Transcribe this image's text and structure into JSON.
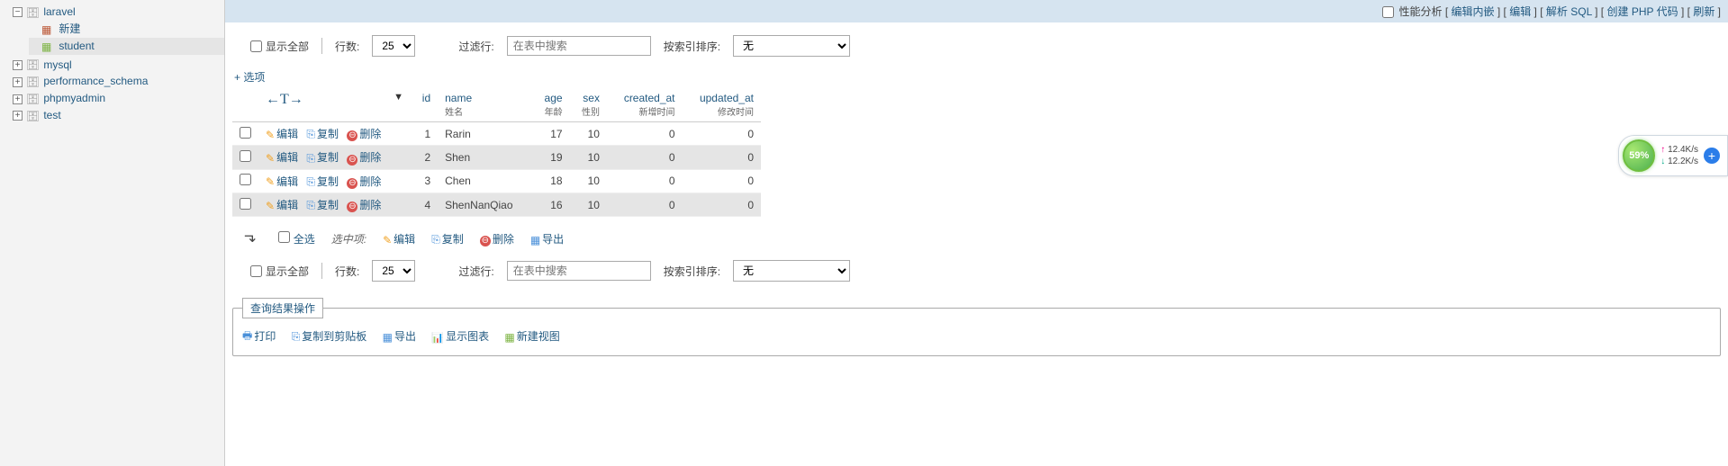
{
  "sidebar": {
    "databases": [
      {
        "name": "laravel",
        "expanded": true,
        "children": [
          {
            "name": "新建",
            "type": "new"
          },
          {
            "name": "student",
            "type": "table",
            "selected": true
          }
        ]
      },
      {
        "name": "mysql",
        "expanded": false
      },
      {
        "name": "performance_schema",
        "expanded": false
      },
      {
        "name": "phpmyadmin",
        "expanded": false
      },
      {
        "name": "test",
        "expanded": false
      }
    ]
  },
  "topbar": {
    "profiling": "性能分析",
    "links": [
      "编辑内嵌",
      "编辑",
      "解析 SQL",
      "创建 PHP 代码",
      "刷新"
    ]
  },
  "controls": {
    "show_all": "显示全部",
    "rows_label": "行数:",
    "rows_value": "25",
    "filter_label": "过滤行:",
    "filter_placeholder": "在表中搜索",
    "sort_label": "按索引排序:",
    "sort_value": "无"
  },
  "options_link": "+ 选项",
  "columns": [
    {
      "key": "id",
      "label": "id",
      "sub": ""
    },
    {
      "key": "name",
      "label": "name",
      "sub": "姓名"
    },
    {
      "key": "age",
      "label": "age",
      "sub": "年龄"
    },
    {
      "key": "sex",
      "label": "sex",
      "sub": "性别"
    },
    {
      "key": "created_at",
      "label": "created_at",
      "sub": "新增时间"
    },
    {
      "key": "updated_at",
      "label": "updated_at",
      "sub": "修改时间"
    }
  ],
  "row_actions": {
    "edit": "编辑",
    "copy": "复制",
    "delete": "删除"
  },
  "rows": [
    {
      "id": 1,
      "name": "Rarin",
      "age": 17,
      "sex": 10,
      "created_at": 0,
      "updated_at": 0
    },
    {
      "id": 2,
      "name": "Shen",
      "age": 19,
      "sex": 10,
      "created_at": 0,
      "updated_at": 0
    },
    {
      "id": 3,
      "name": "Chen",
      "age": 18,
      "sex": 10,
      "created_at": 0,
      "updated_at": 0
    },
    {
      "id": 4,
      "name": "ShenNanQiao",
      "age": 16,
      "sex": 10,
      "created_at": 0,
      "updated_at": 0
    }
  ],
  "bulk": {
    "check_all": "全选",
    "with_selected": "选中项:",
    "edit": "编辑",
    "copy": "复制",
    "delete": "删除",
    "export": "导出"
  },
  "result_ops": {
    "legend": "查询结果操作",
    "print": "打印",
    "clipboard": "复制到剪贴板",
    "export": "导出",
    "chart": "显示图表",
    "view": "新建视图"
  },
  "speed": {
    "percent": "59%",
    "up": "12.4K/s",
    "down": "12.2K/s"
  }
}
